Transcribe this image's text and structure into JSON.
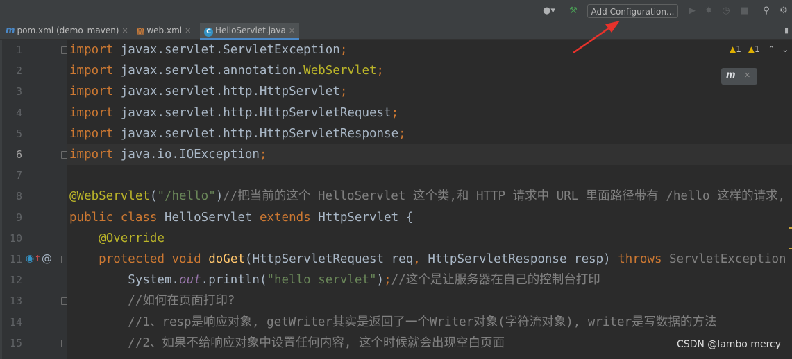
{
  "toolbar": {
    "add_configuration_label": "Add Configuration...",
    "icons": [
      "user-dropdown-icon",
      "build-hammer-icon",
      "run-icon",
      "debug-icon",
      "coverage-icon",
      "stop-icon",
      "search-icon",
      "settings-gear-icon"
    ]
  },
  "tabs": [
    {
      "icon": "m",
      "label": "pom.xml (demo_maven)",
      "active": false
    },
    {
      "icon": "web",
      "label": "web.xml",
      "active": false
    },
    {
      "icon": "C",
      "label": "HelloServlet.java",
      "active": true
    }
  ],
  "editor": {
    "current_line": 6,
    "inspections": {
      "warnings_a": "1",
      "warnings_b": "1"
    },
    "popup_icon": "m",
    "lines": [
      {
        "n": "1",
        "parts": [
          [
            "kw",
            "import"
          ],
          [
            "t",
            " javax.servlet.ServletException"
          ],
          [
            "kw",
            ";"
          ]
        ]
      },
      {
        "n": "2",
        "parts": [
          [
            "kw",
            "import"
          ],
          [
            "t",
            " javax.servlet.annotation."
          ],
          [
            "ann",
            "WebServlet"
          ],
          [
            "kw",
            ";"
          ]
        ]
      },
      {
        "n": "3",
        "parts": [
          [
            "kw",
            "import"
          ],
          [
            "t",
            " javax.servlet.http.HttpServlet"
          ],
          [
            "kw",
            ";"
          ]
        ]
      },
      {
        "n": "4",
        "parts": [
          [
            "kw",
            "import"
          ],
          [
            "t",
            " javax.servlet.http.HttpServletRequest"
          ],
          [
            "kw",
            ";"
          ]
        ]
      },
      {
        "n": "5",
        "parts": [
          [
            "kw",
            "import"
          ],
          [
            "t",
            " javax.servlet.http.HttpServletResponse"
          ],
          [
            "kw",
            ";"
          ]
        ]
      },
      {
        "n": "6",
        "parts": [
          [
            "kw",
            "import"
          ],
          [
            "t",
            " java.io.IOException"
          ],
          [
            "kw",
            ";"
          ]
        ]
      },
      {
        "n": "7",
        "parts": []
      },
      {
        "n": "8",
        "parts": [
          [
            "ann",
            "@WebServlet"
          ],
          [
            "t",
            "("
          ],
          [
            "str",
            "\"/hello\""
          ],
          [
            "t",
            ")"
          ],
          [
            "cm",
            "//把当前的这个 HelloServlet 这个类,和 HTTP 请求中 URL 里面路径带有 /hello 这样的请求,"
          ]
        ]
      },
      {
        "n": "9",
        "parts": [
          [
            "kw",
            "public class"
          ],
          [
            "t",
            " HelloServlet "
          ],
          [
            "kw",
            "extends"
          ],
          [
            "t",
            " HttpServlet {"
          ]
        ]
      },
      {
        "n": "10",
        "parts": [
          [
            "t",
            "    "
          ],
          [
            "ann",
            "@Override"
          ]
        ]
      },
      {
        "n": "11",
        "parts": [
          [
            "t",
            "    "
          ],
          [
            "kw",
            "protected void"
          ],
          [
            "t",
            " "
          ],
          [
            "fn",
            "doGet"
          ],
          [
            "t",
            "(HttpServletRequest req"
          ],
          [
            "kw",
            ","
          ],
          [
            "t",
            " HttpServletResponse resp) "
          ],
          [
            "kw",
            "throws"
          ],
          [
            "dim",
            " ServletException"
          ]
        ]
      },
      {
        "n": "12",
        "parts": [
          [
            "t",
            "        System."
          ],
          [
            "static",
            "out"
          ],
          [
            "t",
            ".println("
          ],
          [
            "str",
            "\"hello servlet\""
          ],
          [
            "t",
            ")"
          ],
          [
            "kw",
            ";"
          ],
          [
            "cm",
            "//这个是让服务器在自己的控制台打印"
          ]
        ]
      },
      {
        "n": "13",
        "parts": [
          [
            "t",
            "        "
          ],
          [
            "cm",
            "//如何在页面打印?"
          ]
        ]
      },
      {
        "n": "14",
        "parts": [
          [
            "t",
            "        "
          ],
          [
            "cm",
            "//1、resp是响应对象, getWriter其实是返回了一个Writer对象(字符流对象), writer是写数据的方法"
          ]
        ]
      },
      {
        "n": "15",
        "parts": [
          [
            "t",
            "        "
          ],
          [
            "cm",
            "//2、如果不给响应对象中设置任何内容, 这个时候就会出现空白页面"
          ]
        ]
      }
    ]
  },
  "watermark": "CSDN @lambo mercy",
  "colors": {
    "background": "#2b2b2b",
    "keyword": "#cc7832",
    "annotation": "#bbb529",
    "string": "#6a8759",
    "comment": "#808080",
    "arrow": "#e8322b"
  }
}
